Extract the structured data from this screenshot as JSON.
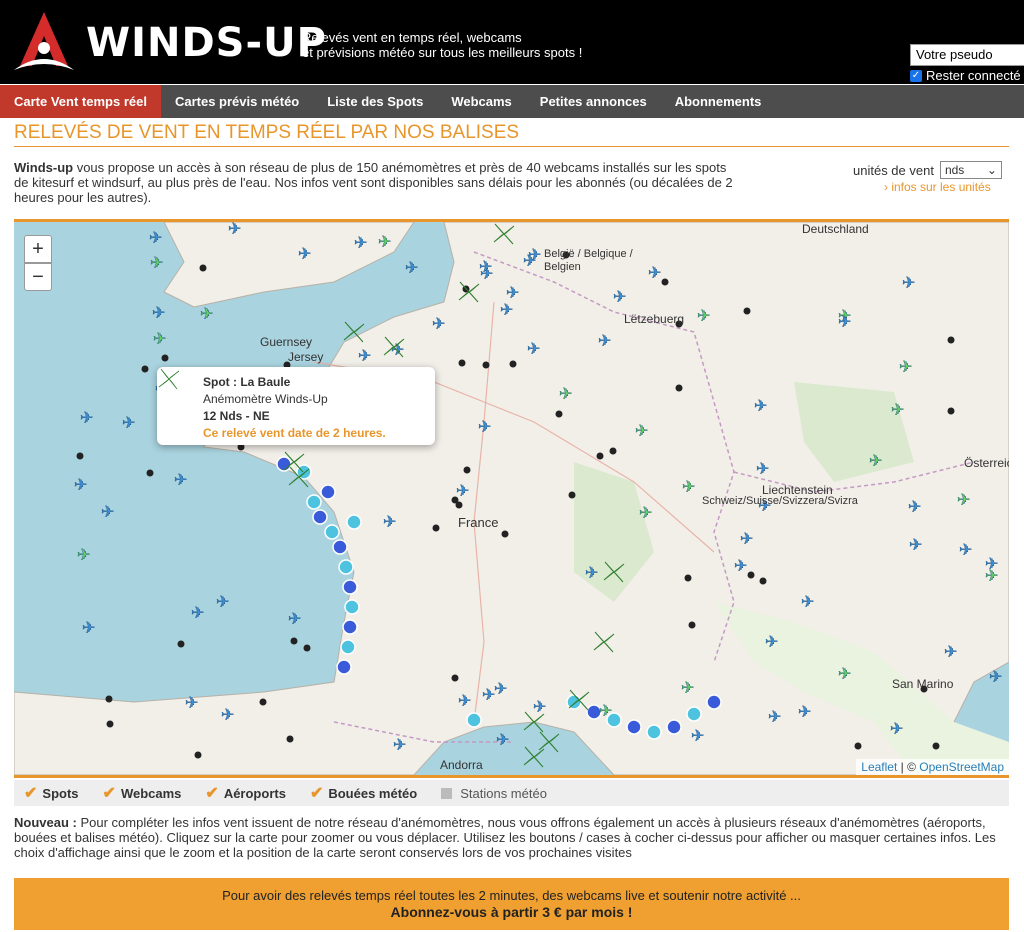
{
  "header": {
    "brand": "WINDS-UP",
    "tagline_line1": "Relevés vent en temps réel, webcams",
    "tagline_line2": "et prévisions météo sur tous les meilleurs spots !",
    "pseudo_value": "Votre pseudo",
    "remember_label": "Rester connecté"
  },
  "nav": {
    "items": [
      "Carte Vent temps réel",
      "Cartes prévis météo",
      "Liste des Spots",
      "Webcams",
      "Petites annonces",
      "Abonnements"
    ],
    "active": 0
  },
  "page": {
    "title": "RELEVÉS DE VENT EN TEMPS RÉEL PAR NOS BALISES",
    "intro_brand": "Winds-up",
    "intro_text": " vous propose un accès à son réseau de plus de 150 anémomètres et près de 40 webcams installés sur les spots de kitesurf et windsurf, au plus près de l'eau. Nos infos vent sont disponibles sans délais pour les abonnés (ou décalées de 2 heures pour les autres).",
    "units_label": "unités de vent",
    "units_value": "nds",
    "units_link": "› infos sur les unités"
  },
  "map": {
    "zoom_in": "+",
    "zoom_out": "−",
    "labels": [
      "Deutschland",
      "België / Belgique / Belgien",
      "Lëtzebuerg",
      "Guernsey",
      "Jersey",
      "France",
      "Liechtenstein",
      "Schweiz/Suisse/Svizzera/Svizra",
      "Österreich",
      "San Marino",
      "Andorra"
    ],
    "popup": {
      "title": "Spot : La Baule",
      "subtitle": "Anémomètre Winds-Up",
      "reading": "12 Nds - NE",
      "warning": "Ce relevé vent date de 2 heures."
    },
    "attribution_leaflet": "Leaflet",
    "attribution_sep": " | © ",
    "attribution_osm": "OpenStreetMap",
    "colors": {
      "sea": "#a9d3df",
      "land": "#f2efe9",
      "green_station": "#5fd35f",
      "blue_station": "#3a5bd9",
      "cyan_station": "#4ec3e0",
      "buoy": "#222222"
    }
  },
  "legend": {
    "items": [
      {
        "label": "Spots",
        "checked": true
      },
      {
        "label": "Webcams",
        "checked": true
      },
      {
        "label": "Aéroports",
        "checked": true
      },
      {
        "label": "Bouées météo",
        "checked": true
      },
      {
        "label": "Stations météo",
        "checked": false
      }
    ]
  },
  "news": {
    "label": "Nouveau :",
    "text": " Pour compléter les infos vent issuent de notre réseau d'anémomètres, nous vous offrons également un accès à plusieurs réseaux d'anémomètres (aéroports, bouées et balises météo). Cliquez sur la carte pour zoomer ou vous déplacer. Utilisez les boutons / cases à cocher ci-dessus pour afficher ou masquer certaines infos. Les choix d'affichage ainsi que le zoom et la position de la carte seront conservés lors de vos prochaines visites"
  },
  "cta": {
    "line1": "Pour avoir des relevés temps réel toutes les 2 minutes, des webcams live et soutenir notre activité ...",
    "line2": "Abonnez-vous à partir 3 € par mois !"
  }
}
